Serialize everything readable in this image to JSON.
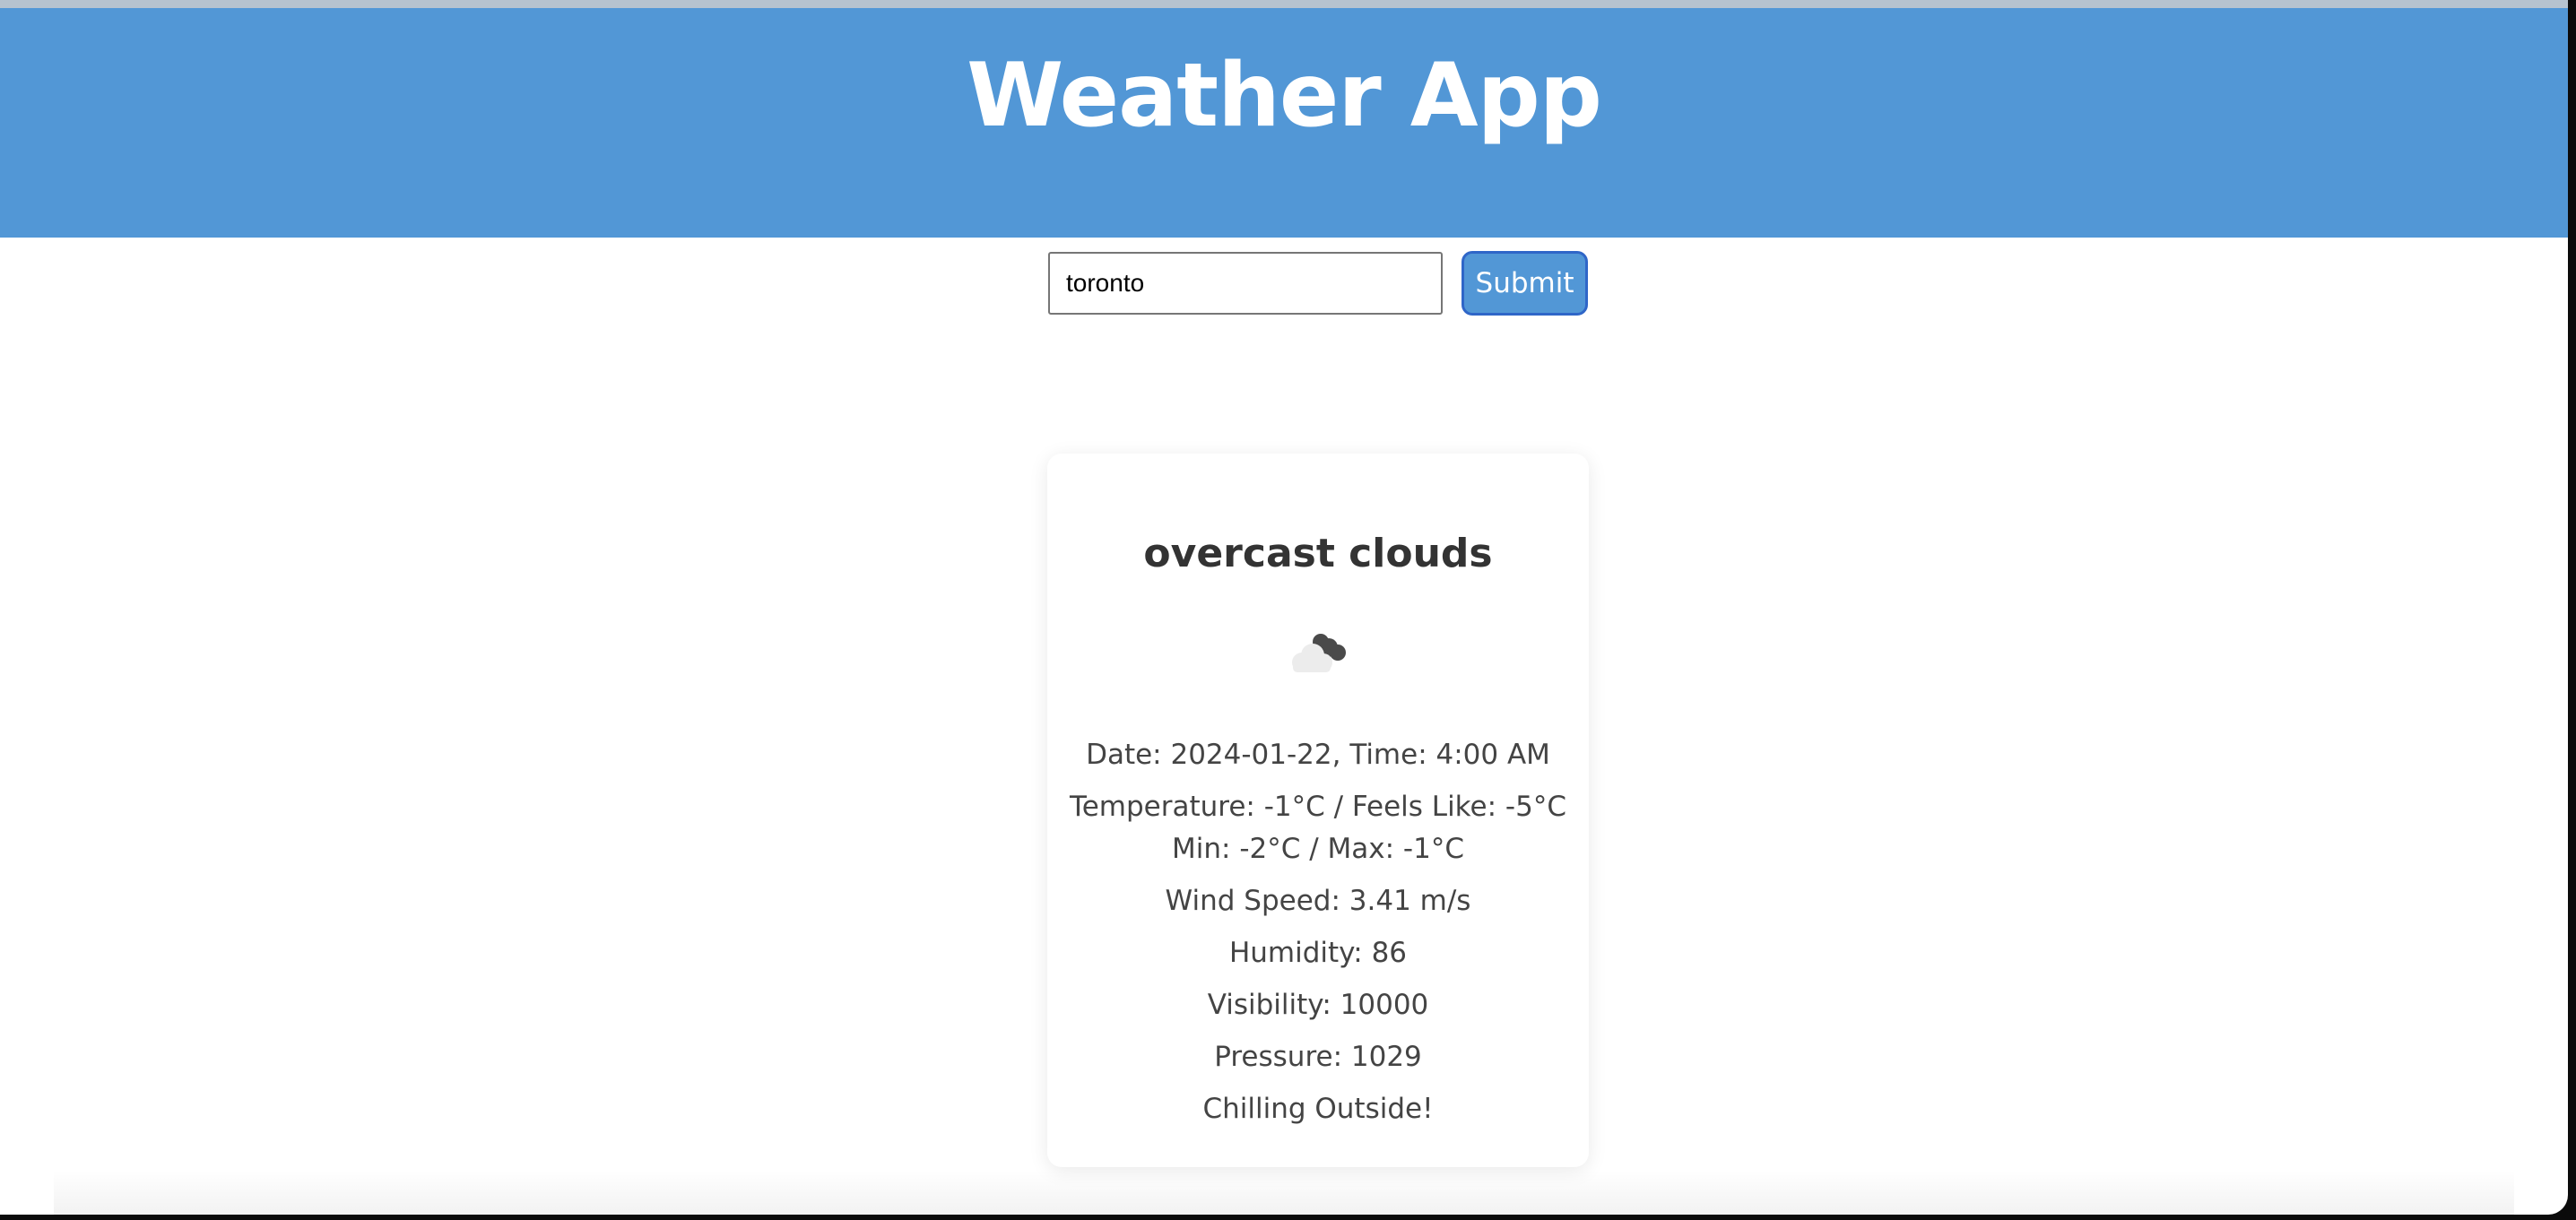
{
  "header": {
    "title": "Weather App"
  },
  "search": {
    "value": "toronto",
    "submit_label": "Submit"
  },
  "weather": {
    "description": "overcast clouds",
    "icon": "overcast-clouds-icon",
    "date_time": "Date: 2024-01-22, Time: 4:00 AM",
    "temperature": "Temperature: -1°C / Feels Like: -5°C",
    "min_max": "Min: -2°C / Max: -1°C",
    "wind_speed": "Wind Speed: 3.41 m/s",
    "humidity": "Humidity: 86",
    "visibility": "Visibility: 10000",
    "pressure": "Pressure: 1029",
    "message": "Chilling Outside!"
  },
  "colors": {
    "header_bg": "#5297d6",
    "button_border": "#2f66c8",
    "text": "#333333"
  }
}
